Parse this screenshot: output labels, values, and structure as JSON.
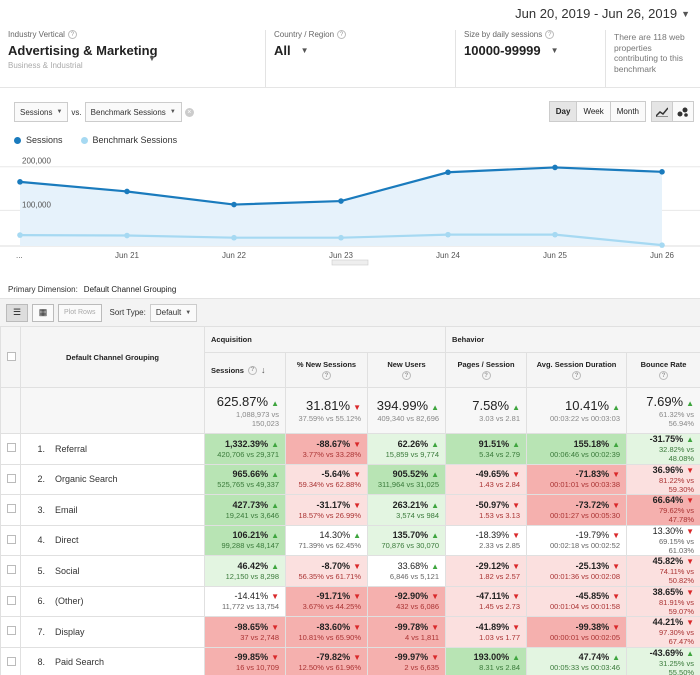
{
  "header": {
    "date_range": "Jun 20, 2019 - Jun 26, 2019"
  },
  "filters": {
    "industry": {
      "label": "Industry Vertical",
      "value": "Advertising & Marketing",
      "sub": "Business & Industrial"
    },
    "country": {
      "label": "Country / Region",
      "value": "All"
    },
    "size": {
      "label": "Size by daily sessions",
      "value": "10000-99999"
    },
    "note": "There are 118 web properties contributing to this benchmark"
  },
  "controls": {
    "metric1": "Sessions",
    "vs": "vs.",
    "metric2": "Benchmark Sessions",
    "periods": [
      "Day",
      "Week",
      "Month"
    ],
    "active_period": "Day"
  },
  "legend": [
    {
      "name": "Sessions",
      "color": "#1a7bbd"
    },
    {
      "name": "Benchmark Sessions",
      "color": "#a6d9f2"
    }
  ],
  "chart_data": {
    "type": "line",
    "x": [
      "...",
      "Jun 21",
      "Jun 22",
      "Jun 23",
      "Jun 24",
      "Jun 25",
      "Jun 26"
    ],
    "ylabels": [
      "200,000",
      "100,000"
    ],
    "ylim": [
      0,
      220000
    ],
    "series": [
      {
        "name": "Sessions",
        "values": [
          147000,
          125000,
          95000,
          103000,
          169000,
          180000,
          170000
        ]
      },
      {
        "name": "Benchmark Sessions",
        "values": [
          25000,
          24000,
          19000,
          19000,
          26000,
          26000,
          2000
        ]
      }
    ]
  },
  "table_controls": {
    "primary_dimension_label": "Primary Dimension:",
    "primary_dimension_value": "Default Channel Grouping",
    "plot_rows": "Plot Rows",
    "sort_type_label": "Sort Type:",
    "sort_type_value": "Default"
  },
  "table": {
    "dimension_header": "Default Channel Grouping",
    "groups": {
      "acquisition": "Acquisition",
      "behavior": "Behavior"
    },
    "columns": [
      "Sessions",
      "% New Sessions",
      "New Users",
      "Pages / Session",
      "Avg. Session Duration",
      "Bounce Rate"
    ],
    "totals": [
      {
        "pct": "625.87%",
        "dir": "up",
        "cmp": "1,088,973 vs 150,023"
      },
      {
        "pct": "31.81%",
        "dir": "dn",
        "cmp": "37.59% vs 55.12%"
      },
      {
        "pct": "394.99%",
        "dir": "up",
        "cmp": "409,340 vs 82,696"
      },
      {
        "pct": "7.58%",
        "dir": "up",
        "cmp": "3.03 vs 2.81"
      },
      {
        "pct": "10.41%",
        "dir": "up",
        "cmp": "00:03:22 vs 00:03:03"
      },
      {
        "pct": "7.69%",
        "dir": "up",
        "cmp": "61.32% vs 56.94%"
      }
    ],
    "rows": [
      {
        "idx": "1.",
        "name": "Referral",
        "cells": [
          {
            "pct": "1,332.39%",
            "dir": "up",
            "cmp": "420,706 vs 29,371",
            "bg": "green"
          },
          {
            "pct": "-88.67%",
            "dir": "dn",
            "cmp": "3.77% vs 33.28%",
            "bg": "red"
          },
          {
            "pct": "62.26%",
            "dir": "up",
            "cmp": "15,859 vs 9,774",
            "bg": "lgreen"
          },
          {
            "pct": "91.51%",
            "dir": "up",
            "cmp": "5.34 vs 2.79",
            "bg": "green"
          },
          {
            "pct": "155.18%",
            "dir": "up",
            "cmp": "00:06:46 vs 00:02:39",
            "bg": "green"
          },
          {
            "pct": "-31.75%",
            "dir": "up",
            "cmp": "32.82% vs 48.08%",
            "bg": "lgreen"
          }
        ]
      },
      {
        "idx": "2.",
        "name": "Organic Search",
        "cells": [
          {
            "pct": "965.66%",
            "dir": "up",
            "cmp": "525,765 vs 49,337",
            "bg": "green"
          },
          {
            "pct": "-5.64%",
            "dir": "dn",
            "cmp": "59.34% vs 62.88%",
            "bg": "lred"
          },
          {
            "pct": "905.52%",
            "dir": "up",
            "cmp": "311,964 vs 31,025",
            "bg": "green"
          },
          {
            "pct": "-49.65%",
            "dir": "dn",
            "cmp": "1.43 vs 2.84",
            "bg": "lred"
          },
          {
            "pct": "-71.83%",
            "dir": "dn",
            "cmp": "00:01:01 vs 00:03:38",
            "bg": "red"
          },
          {
            "pct": "36.96%",
            "dir": "dn",
            "cmp": "81.22% vs 59.30%",
            "bg": "lred"
          }
        ]
      },
      {
        "idx": "3.",
        "name": "Email",
        "cells": [
          {
            "pct": "427.73%",
            "dir": "up",
            "cmp": "19,241 vs 3,646",
            "bg": "green"
          },
          {
            "pct": "-31.17%",
            "dir": "dn",
            "cmp": "18.57% vs 26.99%",
            "bg": "lred"
          },
          {
            "pct": "263.21%",
            "dir": "up",
            "cmp": "3,574 vs 984",
            "bg": "lgreen"
          },
          {
            "pct": "-50.97%",
            "dir": "dn",
            "cmp": "1.53 vs 3.13",
            "bg": "lred"
          },
          {
            "pct": "-73.72%",
            "dir": "dn",
            "cmp": "00:01:27 vs 00:05:30",
            "bg": "red"
          },
          {
            "pct": "66.64%",
            "dir": "dn",
            "cmp": "79.62% vs 47.78%",
            "bg": "red"
          }
        ]
      },
      {
        "idx": "4.",
        "name": "Direct",
        "cells": [
          {
            "pct": "106.21%",
            "dir": "up",
            "cmp": "99,288 vs 48,147",
            "bg": "green"
          },
          {
            "pct": "14.30%",
            "dir": "up",
            "cmp": "71.39% vs 62.45%",
            "bg": "white"
          },
          {
            "pct": "135.70%",
            "dir": "up",
            "cmp": "70,876 vs 30,070",
            "bg": "lgreen"
          },
          {
            "pct": "-18.39%",
            "dir": "dn",
            "cmp": "2.33 vs 2.85",
            "bg": "white"
          },
          {
            "pct": "-19.79%",
            "dir": "dn",
            "cmp": "00:02:18 vs 00:02:52",
            "bg": "white"
          },
          {
            "pct": "13.30%",
            "dir": "dn",
            "cmp": "69.15% vs 61.03%",
            "bg": "white"
          }
        ]
      },
      {
        "idx": "5.",
        "name": "Social",
        "cells": [
          {
            "pct": "46.42%",
            "dir": "up",
            "cmp": "12,150 vs 8,298",
            "bg": "lgreen"
          },
          {
            "pct": "-8.70%",
            "dir": "dn",
            "cmp": "56.35% vs 61.71%",
            "bg": "lred"
          },
          {
            "pct": "33.68%",
            "dir": "up",
            "cmp": "6,846 vs 5,121",
            "bg": "white"
          },
          {
            "pct": "-29.12%",
            "dir": "dn",
            "cmp": "1.82 vs 2.57",
            "bg": "lred"
          },
          {
            "pct": "-25.13%",
            "dir": "dn",
            "cmp": "00:01:36 vs 00:02:08",
            "bg": "lred"
          },
          {
            "pct": "45.82%",
            "dir": "dn",
            "cmp": "74.11% vs 50.82%",
            "bg": "lred"
          }
        ]
      },
      {
        "idx": "6.",
        "name": "(Other)",
        "cells": [
          {
            "pct": "-14.41%",
            "dir": "dn",
            "cmp": "11,772 vs 13,754",
            "bg": "white"
          },
          {
            "pct": "-91.71%",
            "dir": "dn",
            "cmp": "3.67% vs 44.25%",
            "bg": "red"
          },
          {
            "pct": "-92.90%",
            "dir": "dn",
            "cmp": "432 vs 6,086",
            "bg": "red"
          },
          {
            "pct": "-47.11%",
            "dir": "dn",
            "cmp": "1.45 vs 2.73",
            "bg": "lred"
          },
          {
            "pct": "-45.85%",
            "dir": "dn",
            "cmp": "00:01:04 vs 00:01:58",
            "bg": "lred"
          },
          {
            "pct": "38.65%",
            "dir": "dn",
            "cmp": "81.91% vs 59.07%",
            "bg": "lred"
          }
        ]
      },
      {
        "idx": "7.",
        "name": "Display",
        "cells": [
          {
            "pct": "-98.65%",
            "dir": "dn",
            "cmp": "37 vs 2,748",
            "bg": "red"
          },
          {
            "pct": "-83.60%",
            "dir": "dn",
            "cmp": "10.81% vs 65.90%",
            "bg": "red"
          },
          {
            "pct": "-99.78%",
            "dir": "dn",
            "cmp": "4 vs 1,811",
            "bg": "red"
          },
          {
            "pct": "-41.89%",
            "dir": "dn",
            "cmp": "1.03 vs 1.77",
            "bg": "lred"
          },
          {
            "pct": "-99.38%",
            "dir": "dn",
            "cmp": "00:00:01 vs 00:02:05",
            "bg": "red"
          },
          {
            "pct": "44.21%",
            "dir": "dn",
            "cmp": "97.30% vs 67.47%",
            "bg": "lred"
          }
        ]
      },
      {
        "idx": "8.",
        "name": "Paid Search",
        "cells": [
          {
            "pct": "-99.85%",
            "dir": "dn",
            "cmp": "16 vs 10,709",
            "bg": "red"
          },
          {
            "pct": "-79.82%",
            "dir": "dn",
            "cmp": "12.50% vs 61.96%",
            "bg": "red"
          },
          {
            "pct": "-99.97%",
            "dir": "dn",
            "cmp": "2 vs 6,635",
            "bg": "red"
          },
          {
            "pct": "193.00%",
            "dir": "up",
            "cmp": "8.31 vs 2.84",
            "bg": "green"
          },
          {
            "pct": "47.74%",
            "dir": "up",
            "cmp": "00:05:33 vs 00:03:46",
            "bg": "lgreen"
          },
          {
            "pct": "-43.69%",
            "dir": "up",
            "cmp": "31.25% vs 55.50%",
            "bg": "lgreen"
          }
        ]
      }
    ]
  }
}
